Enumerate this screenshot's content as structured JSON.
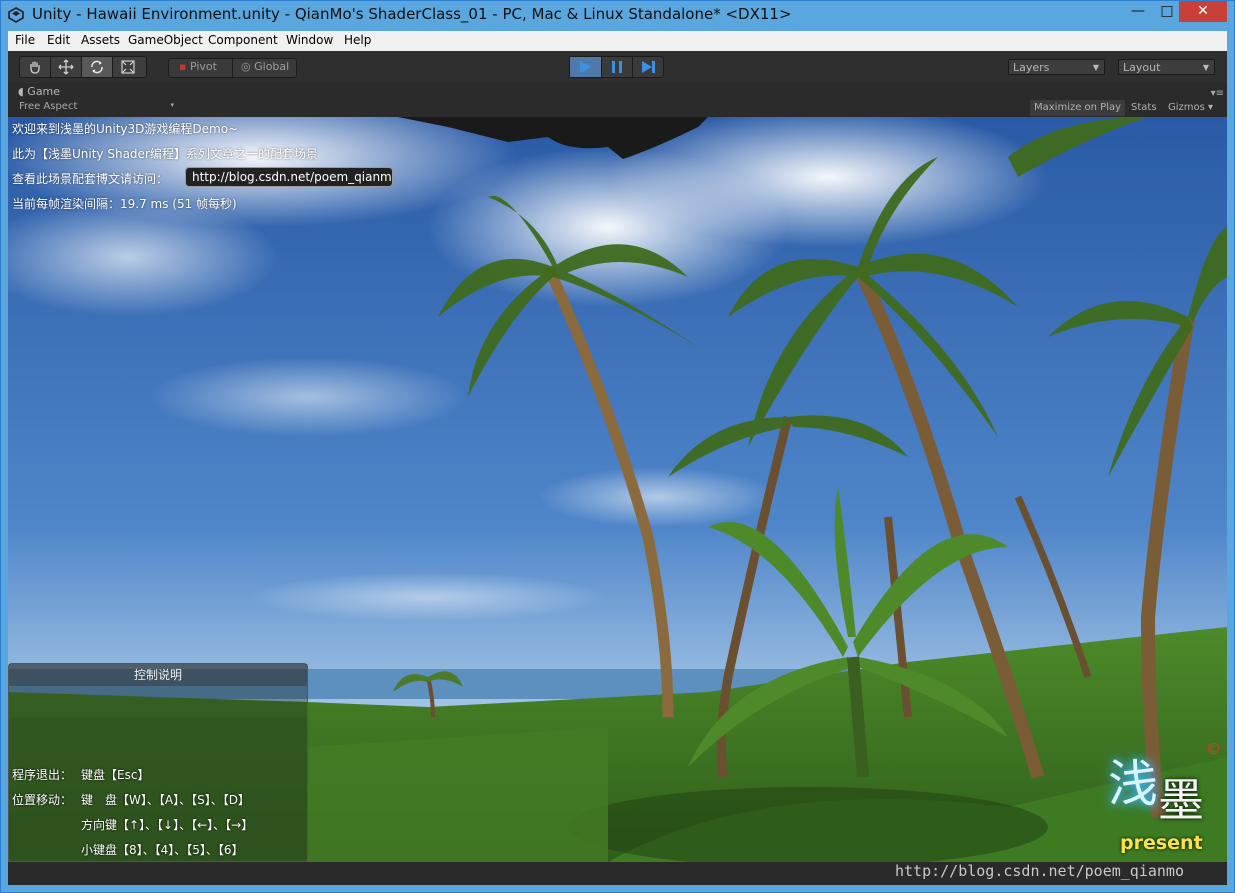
{
  "window": {
    "title": "Unity - Hawaii Environment.unity - QianMo's ShaderClass_01 - PC, Mac & Linux Standalone* <DX11>",
    "minimize": "—",
    "maximize": "□",
    "close": "✕"
  },
  "menu": [
    "File",
    "Edit",
    "Assets",
    "GameObject",
    "Component",
    "Window",
    "Help"
  ],
  "toolbar": {
    "pivot": "Pivot",
    "global": "Global",
    "layers": "Layers",
    "layout": "Layout"
  },
  "game_panel": {
    "tab": "Game",
    "aspect": "Free Aspect",
    "maximize_on_play": "Maximize on Play",
    "stats": "Stats",
    "gizmos": "Gizmos"
  },
  "overlay": {
    "line1": "欢迎来到浅墨的Unity3D游戏编程Demo~",
    "line2": "此为【浅墨Unity Shader编程】系列文章之一的配套场景",
    "line3_label": "查看此场景配套博文请访问：",
    "url": "http://blog.csdn.net/poem_qianmo",
    "frame_time": "当前每帧渲染间隔：19.7 ms (51 帧每秒)"
  },
  "help": {
    "title": "控制说明",
    "quit_label": "程序退出：",
    "quit_value": "键盘【Esc】",
    "move_label": "位置移动：",
    "move_keys": "键　盘【W】、【A】、【S】、【D】",
    "move_arrows": "方向键【↑】、【↓】、【←】、【→】",
    "move_numpad": "小键盘【8】、【4】、【5】、【6】"
  },
  "logo": {
    "char1": "浅",
    "char2": "墨",
    "present": "present",
    "copyright": "©"
  },
  "watermark": "http://blog.csdn.net/poem_qianmo",
  "colors": {
    "title_bar": "#5aa7e0",
    "close_button": "#c7403a",
    "editor_dark": "#2f2f2f",
    "play_active": "#4f79a8",
    "sky": "#3d6fb6",
    "grass": "#3d7a22"
  }
}
